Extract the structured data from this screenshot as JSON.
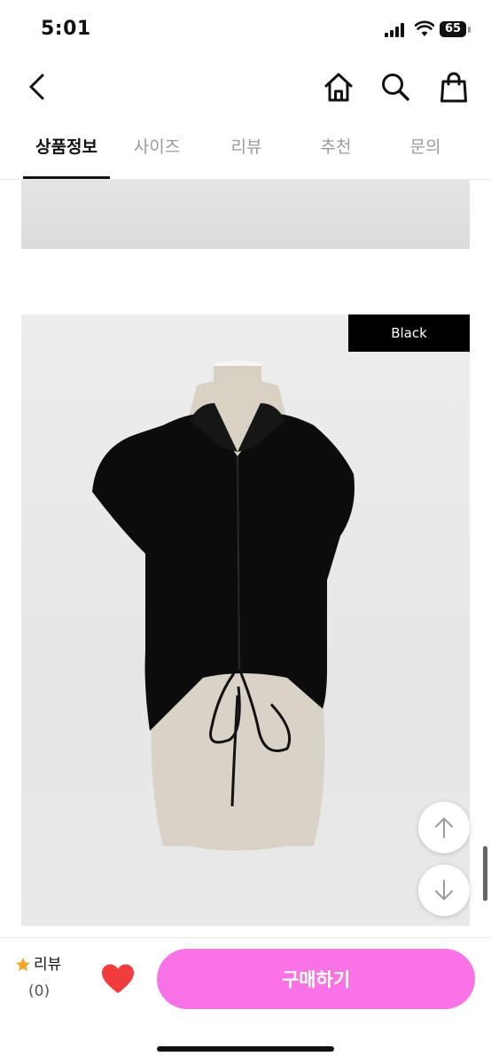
{
  "status_bar": {
    "time": "5:01",
    "battery": "65"
  },
  "tabs": [
    {
      "label": "상품정보",
      "active": true
    },
    {
      "label": "사이즈",
      "active": false
    },
    {
      "label": "리뷰",
      "active": false
    },
    {
      "label": "추천",
      "active": false
    },
    {
      "label": "문의",
      "active": false
    }
  ],
  "product_image": {
    "color_label": "Black"
  },
  "bottom_bar": {
    "review_label": "리뷰",
    "review_count": "(0)",
    "buy_label": "구매하기"
  },
  "colors": {
    "accent": "#f972e6",
    "heart": "#f03c3c",
    "star": "#f5a623"
  },
  "icons": [
    "back-icon",
    "home-icon",
    "search-icon",
    "shopping-bag-icon",
    "arrow-up-icon",
    "arrow-down-icon",
    "star-icon",
    "heart-icon"
  ]
}
